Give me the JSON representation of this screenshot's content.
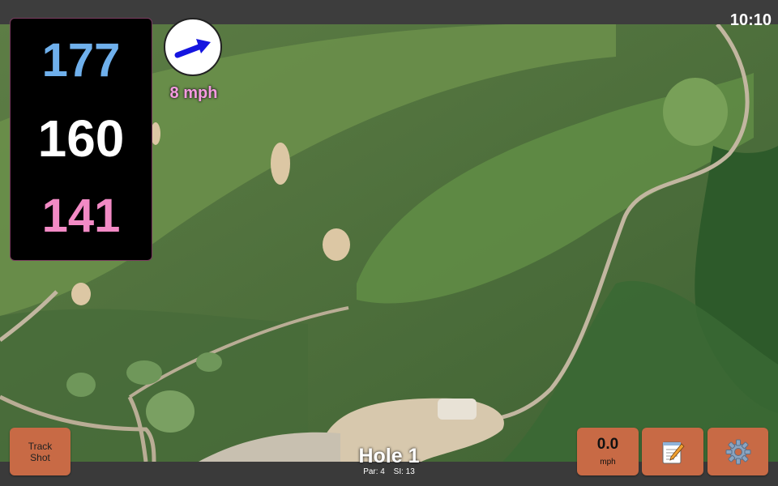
{
  "status": {
    "time": "10:10"
  },
  "distances": {
    "back": "177",
    "middle": "160",
    "front": "141"
  },
  "wind": {
    "speed": "8 mph",
    "direction_icon": "arrow-icon",
    "arrow_color": "#1515e0"
  },
  "hole": {
    "title": "Hole 1",
    "par": "Par: 4",
    "si": "SI: 13"
  },
  "buttons": {
    "track_shot": "Track Shot",
    "speed_value": "0.0",
    "speed_unit": "mph",
    "notes_icon": "notepad-icon",
    "settings_icon": "gear-icon"
  },
  "colors": {
    "accent_button": "#c86a45",
    "back_distance": "#6fb0ec",
    "front_distance": "#f28ac5",
    "wind_text": "#f59be0"
  }
}
